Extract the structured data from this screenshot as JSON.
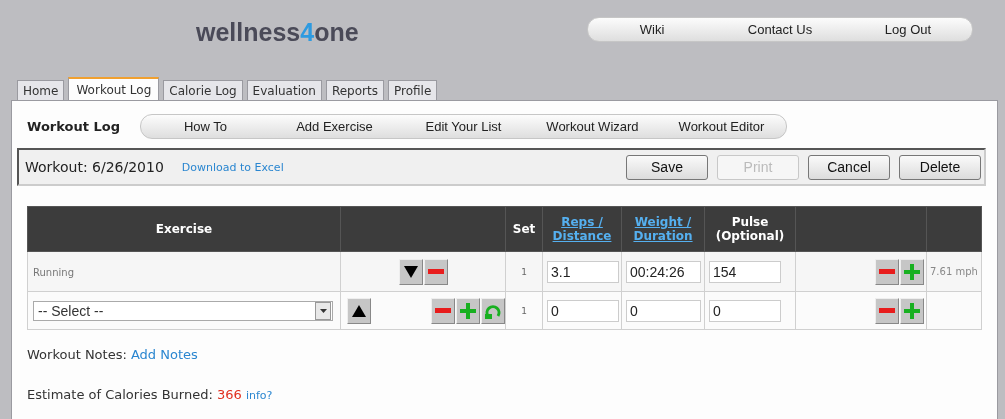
{
  "header": {
    "logo": {
      "before": "wellness",
      "accent": "4",
      "after": "one"
    },
    "nav": [
      "Wiki",
      "Contact Us",
      "Log Out"
    ]
  },
  "tabs": [
    {
      "label": "Home",
      "selected": false
    },
    {
      "label": "Workout Log",
      "selected": true
    },
    {
      "label": "Calorie Log",
      "selected": false
    },
    {
      "label": "Evaluation",
      "selected": false
    },
    {
      "label": "Reports",
      "selected": false
    },
    {
      "label": "Profile",
      "selected": false
    }
  ],
  "page_title": "Workout Log",
  "subnav": [
    "How To",
    "Add Exercise",
    "Edit Your List",
    "Workout Wizard",
    "Workout Editor"
  ],
  "workout_bar": {
    "label": "Workout: 6/26/2010",
    "export_link": "Download to Excel",
    "buttons": [
      {
        "label": "Save",
        "disabled": false
      },
      {
        "label": "Print",
        "disabled": true
      },
      {
        "label": "Cancel",
        "disabled": false
      },
      {
        "label": "Delete",
        "disabled": false
      }
    ]
  },
  "table": {
    "columns": [
      {
        "label": "Exercise",
        "link": false
      },
      {
        "label": "Set",
        "link": false
      },
      {
        "label": "Reps / Distance",
        "link": true
      },
      {
        "label": "Weight / Duration",
        "link": true
      },
      {
        "label": "Pulse (Optional)",
        "link": false
      }
    ],
    "rows": [
      {
        "kind": "logged",
        "exercise": "Running",
        "set": "1",
        "reps_distance": "3.1",
        "weight_duration": "00:24:26",
        "pulse": "154",
        "speed": "7.61 mph"
      },
      {
        "kind": "new",
        "exercise": "-- Select --",
        "set": "1",
        "reps_distance": "0",
        "weight_duration": "0",
        "pulse": "0"
      }
    ]
  },
  "notes": {
    "label": "Workout Notes:",
    "link": "Add Notes"
  },
  "calories": {
    "label": "Estimate of Calories Burned:",
    "value": "366",
    "info": "info?"
  }
}
